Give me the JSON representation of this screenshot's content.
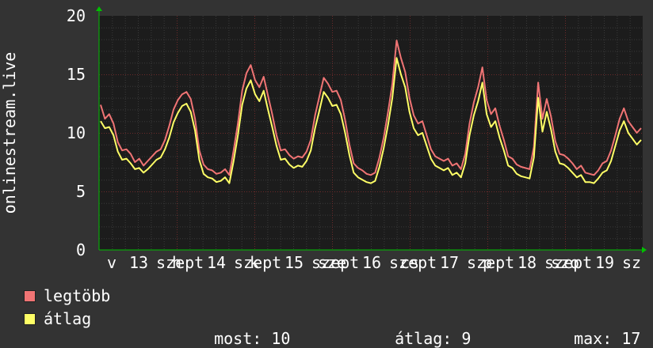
{
  "chart_data": {
    "type": "line",
    "ylabel": "onlinestream.live",
    "ylim": [
      0,
      20
    ],
    "y_ticks": [
      "0",
      "5",
      "10",
      "15",
      "20"
    ],
    "x_tick_labels": [
      "v",
      "13",
      "szept",
      "h",
      "14",
      "szept",
      "k",
      "15",
      "szept",
      "sze",
      "16",
      "szept",
      "cs",
      "17",
      "szept",
      "p",
      "18",
      "szept",
      "szo",
      "19",
      "sz"
    ],
    "grid": true,
    "legend_placement": "bottom",
    "colors": {
      "legtobb": "#f07474",
      "atlag": "#ffff66",
      "background": "#1c1c1c",
      "grid_minor": "#3a3a3a",
      "grid_major": "#6b2a2a",
      "axis_arrow": "#00c000"
    },
    "series": [
      {
        "name": "legtöbb",
        "color": "#f07474",
        "values": [
          12.4,
          11.2,
          11.6,
          10.8,
          9.2,
          8.5,
          8.6,
          8.2,
          7.5,
          7.8,
          7.2,
          7.6,
          8.0,
          8.4,
          8.6,
          9.4,
          10.6,
          12.0,
          12.8,
          13.3,
          13.5,
          12.9,
          11.2,
          8.5,
          7.3,
          6.9,
          6.8,
          6.5,
          6.6,
          6.9,
          6.4,
          8.5,
          10.8,
          13.6,
          15.1,
          15.8,
          14.5,
          13.9,
          14.8,
          13.2,
          11.6,
          9.8,
          8.5,
          8.6,
          8.1,
          7.8,
          8.0,
          7.9,
          8.4,
          9.4,
          11.5,
          13.1,
          14.7,
          14.2,
          13.5,
          13.6,
          12.8,
          11.1,
          9.0,
          7.4,
          7.0,
          6.8,
          6.5,
          6.4,
          6.6,
          7.9,
          9.6,
          11.8,
          14.2,
          17.9,
          16.4,
          15.2,
          13.0,
          11.5,
          10.8,
          11.0,
          9.8,
          8.6,
          8.0,
          7.8,
          7.6,
          7.8,
          7.2,
          7.4,
          6.9,
          8.2,
          10.8,
          12.6,
          13.9,
          15.6,
          12.8,
          11.6,
          12.1,
          10.6,
          9.4,
          8.0,
          7.8,
          7.3,
          7.1,
          7.0,
          6.9,
          8.8,
          14.3,
          11.2,
          12.9,
          11.4,
          9.3,
          8.2,
          8.1,
          7.8,
          7.4,
          6.9,
          7.2,
          6.6,
          6.5,
          6.4,
          6.8,
          7.4,
          7.6,
          8.5,
          9.8,
          11.2,
          12.1,
          11.0,
          10.5,
          10.0,
          10.4
        ]
      },
      {
        "name": "átlag",
        "color": "#ffff66",
        "values": [
          11.0,
          10.4,
          10.5,
          9.8,
          8.4,
          7.7,
          7.8,
          7.4,
          6.9,
          7.0,
          6.6,
          6.9,
          7.3,
          7.7,
          7.9,
          8.6,
          9.6,
          10.9,
          11.7,
          12.3,
          12.5,
          11.8,
          10.2,
          7.7,
          6.5,
          6.2,
          6.1,
          5.8,
          5.9,
          6.2,
          5.7,
          7.6,
          9.8,
          12.4,
          13.8,
          14.5,
          13.3,
          12.7,
          13.6,
          12.0,
          10.5,
          8.9,
          7.7,
          7.8,
          7.3,
          7.0,
          7.2,
          7.1,
          7.6,
          8.5,
          10.4,
          11.9,
          13.5,
          13.0,
          12.3,
          12.4,
          11.6,
          10.0,
          8.1,
          6.6,
          6.2,
          6.0,
          5.8,
          5.7,
          5.9,
          7.1,
          8.7,
          10.7,
          13.0,
          16.4,
          15.0,
          13.9,
          11.8,
          10.4,
          9.8,
          10.0,
          8.9,
          7.8,
          7.2,
          7.0,
          6.8,
          7.0,
          6.4,
          6.6,
          6.2,
          7.4,
          9.8,
          11.5,
          12.7,
          14.3,
          11.6,
          10.5,
          11.0,
          9.6,
          8.5,
          7.2,
          7.0,
          6.5,
          6.3,
          6.2,
          6.1,
          7.9,
          13.0,
          10.1,
          11.8,
          10.3,
          8.4,
          7.4,
          7.3,
          7.0,
          6.6,
          6.2,
          6.4,
          5.8,
          5.8,
          5.7,
          6.1,
          6.6,
          6.8,
          7.6,
          8.9,
          10.2,
          11.0,
          10.0,
          9.5,
          9.0,
          9.4
        ]
      }
    ],
    "legend": [
      "legtöbb",
      "átlag"
    ],
    "stats": {
      "now_label": "most:",
      "now_value": "10",
      "avg_label": "átlag:",
      "avg_value": "9",
      "max_label": "max:",
      "max_value": "17"
    }
  }
}
